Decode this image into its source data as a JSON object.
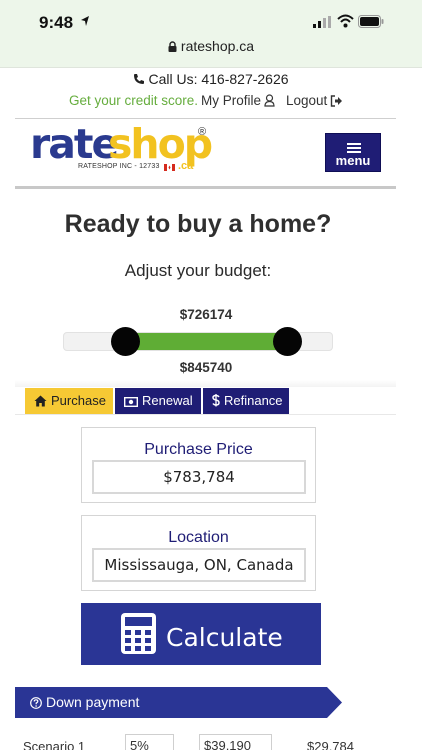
{
  "status_bar": {
    "time": "9:48",
    "url": "rateshop.ca"
  },
  "contact": {
    "call_us": "Call Us: 416-827-2626",
    "credit_score_link": "Get your credit score.",
    "profile_link": "My Profile",
    "logout_link": "Logout"
  },
  "logo": {
    "part1": "rate",
    "part2": "shop",
    "registered": "®",
    "subtitle": "RATESHOP INC - 12733",
    "domain": ".ca"
  },
  "menu": {
    "label": "menu"
  },
  "hero": {
    "title": "Ready to buy a home?",
    "subtitle": "Adjust your budget:"
  },
  "budget": {
    "min_label": "$726174",
    "max_label": "$845740",
    "low_fraction": 0.23,
    "high_fraction": 0.83
  },
  "tabs": [
    {
      "label": "Purchase",
      "icon": "home-icon",
      "active": true
    },
    {
      "label": "Renewal",
      "icon": "money-icon",
      "active": false
    },
    {
      "label": "Refinance",
      "icon": "dollar-icon",
      "active": false
    }
  ],
  "purchase_price": {
    "label": "Purchase Price",
    "value": "$783,784"
  },
  "location": {
    "label": "Location",
    "value": "Mississauga, ON, Canada"
  },
  "calculate": {
    "label": "Calculate",
    "icon": "calculator-icon"
  },
  "down_payment": {
    "label": "Down payment",
    "icon": "question-circle-icon"
  },
  "scenario": {
    "label": "Scenario 1",
    "percent": "5%",
    "amount": "$39,190",
    "value": "$29,784"
  },
  "colors": {
    "navy": "#1f1d75",
    "green": "#5fad35",
    "yellow": "#f6c934",
    "calc_blue": "#2a3595"
  }
}
